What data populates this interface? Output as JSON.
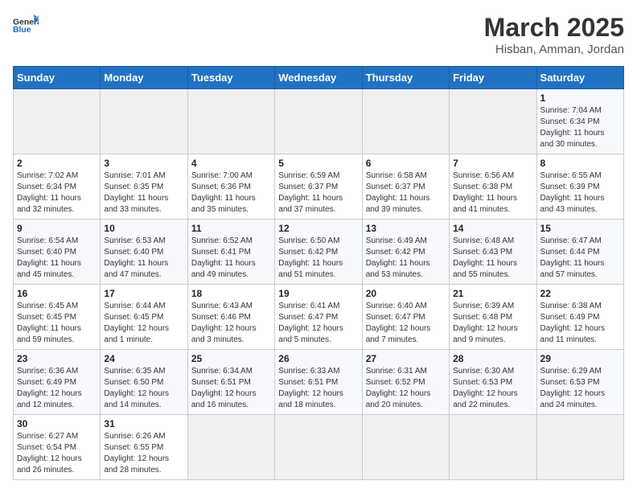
{
  "header": {
    "logo_general": "General",
    "logo_blue": "Blue",
    "month_title": "March 2025",
    "subtitle": "Hisban, Amman, Jordan"
  },
  "weekdays": [
    "Sunday",
    "Monday",
    "Tuesday",
    "Wednesday",
    "Thursday",
    "Friday",
    "Saturday"
  ],
  "weeks": [
    [
      {
        "day": "",
        "info": ""
      },
      {
        "day": "",
        "info": ""
      },
      {
        "day": "",
        "info": ""
      },
      {
        "day": "",
        "info": ""
      },
      {
        "day": "",
        "info": ""
      },
      {
        "day": "",
        "info": ""
      },
      {
        "day": "1",
        "info": "Sunrise: 7:04 AM\nSunset: 6:34 PM\nDaylight: 11 hours\nand 30 minutes."
      }
    ],
    [
      {
        "day": "2",
        "info": "Sunrise: 7:02 AM\nSunset: 6:34 PM\nDaylight: 11 hours\nand 32 minutes."
      },
      {
        "day": "3",
        "info": "Sunrise: 7:01 AM\nSunset: 6:35 PM\nDaylight: 11 hours\nand 33 minutes."
      },
      {
        "day": "4",
        "info": "Sunrise: 7:00 AM\nSunset: 6:36 PM\nDaylight: 11 hours\nand 35 minutes."
      },
      {
        "day": "5",
        "info": "Sunrise: 6:59 AM\nSunset: 6:37 PM\nDaylight: 11 hours\nand 37 minutes."
      },
      {
        "day": "6",
        "info": "Sunrise: 6:58 AM\nSunset: 6:37 PM\nDaylight: 11 hours\nand 39 minutes."
      },
      {
        "day": "7",
        "info": "Sunrise: 6:56 AM\nSunset: 6:38 PM\nDaylight: 11 hours\nand 41 minutes."
      },
      {
        "day": "8",
        "info": "Sunrise: 6:55 AM\nSunset: 6:39 PM\nDaylight: 11 hours\nand 43 minutes."
      }
    ],
    [
      {
        "day": "9",
        "info": "Sunrise: 6:54 AM\nSunset: 6:40 PM\nDaylight: 11 hours\nand 45 minutes."
      },
      {
        "day": "10",
        "info": "Sunrise: 6:53 AM\nSunset: 6:40 PM\nDaylight: 11 hours\nand 47 minutes."
      },
      {
        "day": "11",
        "info": "Sunrise: 6:52 AM\nSunset: 6:41 PM\nDaylight: 11 hours\nand 49 minutes."
      },
      {
        "day": "12",
        "info": "Sunrise: 6:50 AM\nSunset: 6:42 PM\nDaylight: 11 hours\nand 51 minutes."
      },
      {
        "day": "13",
        "info": "Sunrise: 6:49 AM\nSunset: 6:42 PM\nDaylight: 11 hours\nand 53 minutes."
      },
      {
        "day": "14",
        "info": "Sunrise: 6:48 AM\nSunset: 6:43 PM\nDaylight: 11 hours\nand 55 minutes."
      },
      {
        "day": "15",
        "info": "Sunrise: 6:47 AM\nSunset: 6:44 PM\nDaylight: 11 hours\nand 57 minutes."
      }
    ],
    [
      {
        "day": "16",
        "info": "Sunrise: 6:45 AM\nSunset: 6:45 PM\nDaylight: 11 hours\nand 59 minutes."
      },
      {
        "day": "17",
        "info": "Sunrise: 6:44 AM\nSunset: 6:45 PM\nDaylight: 12 hours\nand 1 minute."
      },
      {
        "day": "18",
        "info": "Sunrise: 6:43 AM\nSunset: 6:46 PM\nDaylight: 12 hours\nand 3 minutes."
      },
      {
        "day": "19",
        "info": "Sunrise: 6:41 AM\nSunset: 6:47 PM\nDaylight: 12 hours\nand 5 minutes."
      },
      {
        "day": "20",
        "info": "Sunrise: 6:40 AM\nSunset: 6:47 PM\nDaylight: 12 hours\nand 7 minutes."
      },
      {
        "day": "21",
        "info": "Sunrise: 6:39 AM\nSunset: 6:48 PM\nDaylight: 12 hours\nand 9 minutes."
      },
      {
        "day": "22",
        "info": "Sunrise: 6:38 AM\nSunset: 6:49 PM\nDaylight: 12 hours\nand 11 minutes."
      }
    ],
    [
      {
        "day": "23",
        "info": "Sunrise: 6:36 AM\nSunset: 6:49 PM\nDaylight: 12 hours\nand 12 minutes."
      },
      {
        "day": "24",
        "info": "Sunrise: 6:35 AM\nSunset: 6:50 PM\nDaylight: 12 hours\nand 14 minutes."
      },
      {
        "day": "25",
        "info": "Sunrise: 6:34 AM\nSunset: 6:51 PM\nDaylight: 12 hours\nand 16 minutes."
      },
      {
        "day": "26",
        "info": "Sunrise: 6:33 AM\nSunset: 6:51 PM\nDaylight: 12 hours\nand 18 minutes."
      },
      {
        "day": "27",
        "info": "Sunrise: 6:31 AM\nSunset: 6:52 PM\nDaylight: 12 hours\nand 20 minutes."
      },
      {
        "day": "28",
        "info": "Sunrise: 6:30 AM\nSunset: 6:53 PM\nDaylight: 12 hours\nand 22 minutes."
      },
      {
        "day": "29",
        "info": "Sunrise: 6:29 AM\nSunset: 6:53 PM\nDaylight: 12 hours\nand 24 minutes."
      }
    ],
    [
      {
        "day": "30",
        "info": "Sunrise: 6:27 AM\nSunset: 6:54 PM\nDaylight: 12 hours\nand 26 minutes."
      },
      {
        "day": "31",
        "info": "Sunrise: 6:26 AM\nSunset: 6:55 PM\nDaylight: 12 hours\nand 28 minutes."
      },
      {
        "day": "",
        "info": ""
      },
      {
        "day": "",
        "info": ""
      },
      {
        "day": "",
        "info": ""
      },
      {
        "day": "",
        "info": ""
      },
      {
        "day": "",
        "info": ""
      }
    ]
  ]
}
